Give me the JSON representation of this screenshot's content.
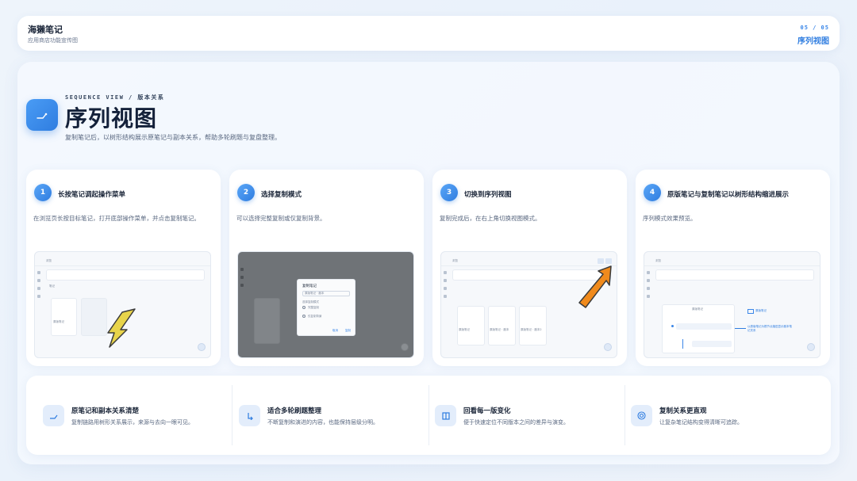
{
  "header": {
    "app_title": "海獭笔记",
    "app_subtitle": "应用商店功能宣传图",
    "page_number": "05 / 05",
    "page_name": "序列视图"
  },
  "hero": {
    "eyebrow": "SEQUENCE VIEW / 版本关系",
    "title": "序列视图",
    "description": "复制笔记后，以树形结构展示原笔记与副本关系，帮助多轮刷题与复盘整理。",
    "icon": "tree-branch-icon"
  },
  "steps": [
    {
      "number": "1",
      "title": "长按笔记调起操作菜单",
      "description": "在浏览页长按目标笔记，打开底部操作菜单，并点击复制笔记。"
    },
    {
      "number": "2",
      "title": "选择复制模式",
      "description": "可以选择完整复制或仅复制背景。"
    },
    {
      "number": "3",
      "title": "切换到序列视图",
      "description": "复制完成后，在右上角切换视图模式。"
    },
    {
      "number": "4",
      "title": "原版笔记与复制笔记以树形结构缩进展示",
      "description": "序列模式效果预览。"
    }
  ],
  "screens": {
    "s1": {
      "header": "浏览",
      "section": "笔记",
      "note_label": "原版笔记"
    },
    "s2": {
      "dialog_title": "复制笔记",
      "input_value": "原版笔记 · 副本",
      "mode_label": "选择复制模式",
      "option_full": "完整复制",
      "option_bg": "仅复制背景",
      "cancel": "取消",
      "confirm": "复制"
    },
    "s3": {
      "header": "浏览",
      "note_a": "原版笔记",
      "note_b": "原版笔记 · 副本",
      "note_c": "原版笔记 · 副本2"
    },
    "s4": {
      "header": "浏览",
      "root_label": "原版笔记",
      "callout_title": "原版笔记",
      "callout_desc": "以原版笔记为根节点缩进显示副本笔记关系"
    }
  },
  "features": [
    {
      "icon": "branch-icon",
      "title": "原笔记和副本关系清楚",
      "description": "复制链路用树形关系展示，来源与去向一眼可见。"
    },
    {
      "icon": "indent-arrow-icon",
      "title": "适合多轮刷题整理",
      "description": "不断复制和演进的内容，也能保持层级分明。"
    },
    {
      "icon": "compare-icon",
      "title": "回看每一版变化",
      "description": "便于快速定位不同版本之间的差异与演变。"
    },
    {
      "icon": "target-icon",
      "title": "复制关系更直观",
      "description": "让复杂笔记结构变得清晰可追踪。"
    }
  ],
  "colors": {
    "accent": "#2f7de0",
    "accent_light": "#e3edfb",
    "arrow_orange": "#f08a1c",
    "arrow_yellow": "#e8d44a"
  }
}
